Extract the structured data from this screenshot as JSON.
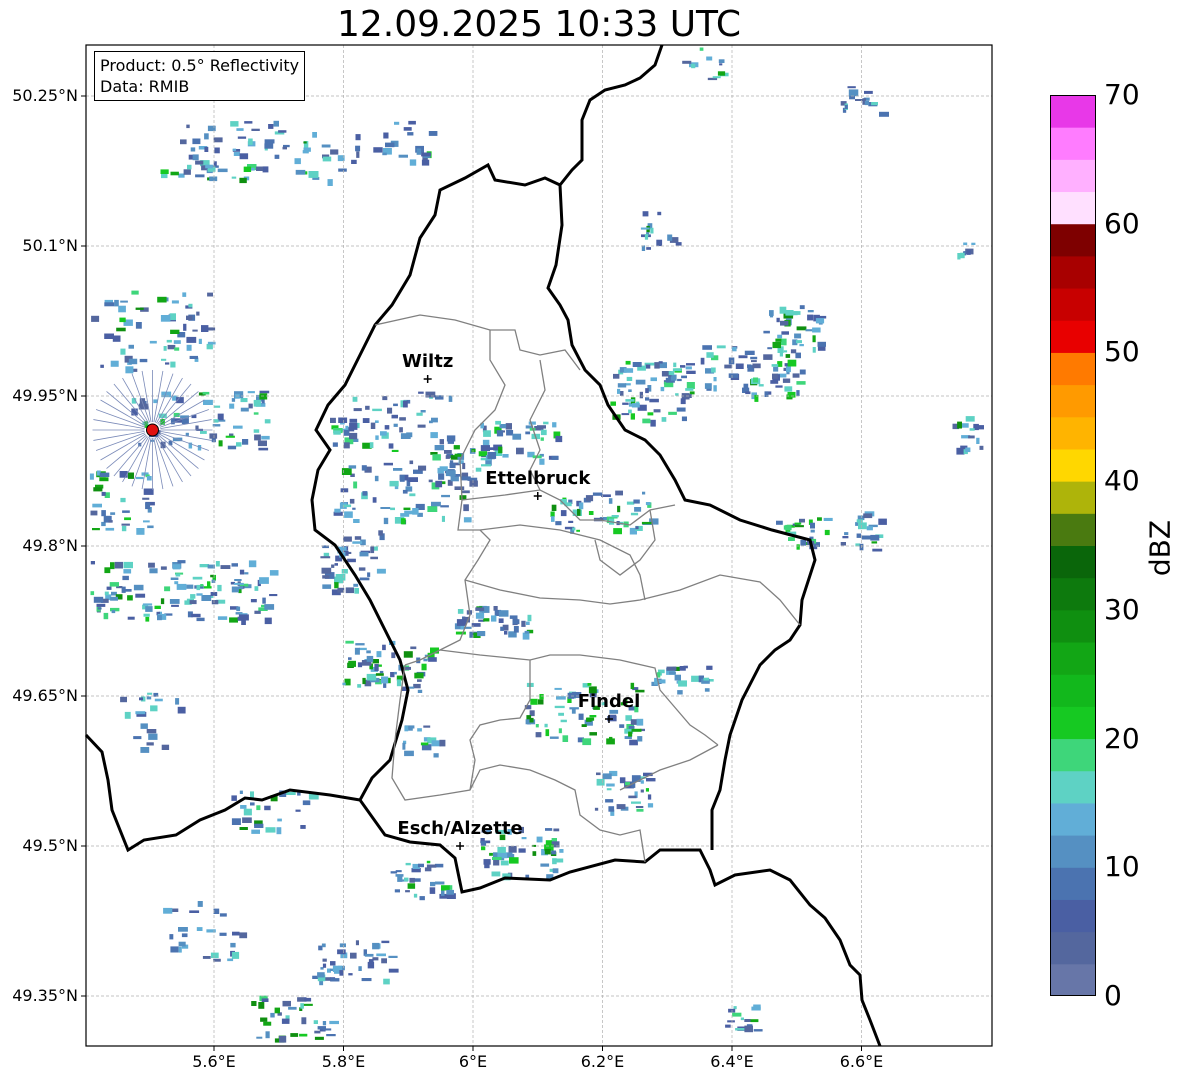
{
  "title": "12.09.2025 10:33 UTC",
  "info_box": {
    "line1": "Product: 0.5° Reflectivity",
    "line2": "Data: RMIB"
  },
  "lat_ticks": [
    "50.25°N",
    "50.1°N",
    "49.95°N",
    "49.8°N",
    "49.65°N",
    "49.5°N",
    "49.35°N"
  ],
  "lon_ticks": [
    "5.6°E",
    "5.8°E",
    "6°E",
    "6.2°E",
    "6.4°E",
    "6.6°E"
  ],
  "cities": [
    {
      "name": "Wiltz",
      "lon": 5.93,
      "lat": 49.967
    },
    {
      "name": "Ettelbruck",
      "lon": 6.1,
      "lat": 49.85
    },
    {
      "name": "Findel",
      "lon": 6.21,
      "lat": 49.627
    },
    {
      "name": "Esch/Alzette",
      "lon": 5.98,
      "lat": 49.5
    }
  ],
  "radar_site": {
    "lon": 5.505,
    "lat": 49.916
  },
  "colorbar": {
    "label": "dBZ",
    "ticks": [
      "0",
      "10",
      "20",
      "30",
      "40",
      "50",
      "60",
      "70"
    ],
    "colors": [
      "#6776a8",
      "#54679e",
      "#4a5fa3",
      "#4b73b0",
      "#5590c2",
      "#61aed7",
      "#5ed2c4",
      "#3ed67a",
      "#16c922",
      "#12b81c",
      "#12a615",
      "#0f8f10",
      "#0d7a0d",
      "#0a660a",
      "#4a7a10",
      "#aeb40a",
      "#ffd700",
      "#ffb400",
      "#ff9a00",
      "#ff7a00",
      "#e80000",
      "#c80000",
      "#a80000",
      "#7e0000",
      "#ffe0ff",
      "#ffb0ff",
      "#ff7cff",
      "#e838e8"
    ]
  }
}
